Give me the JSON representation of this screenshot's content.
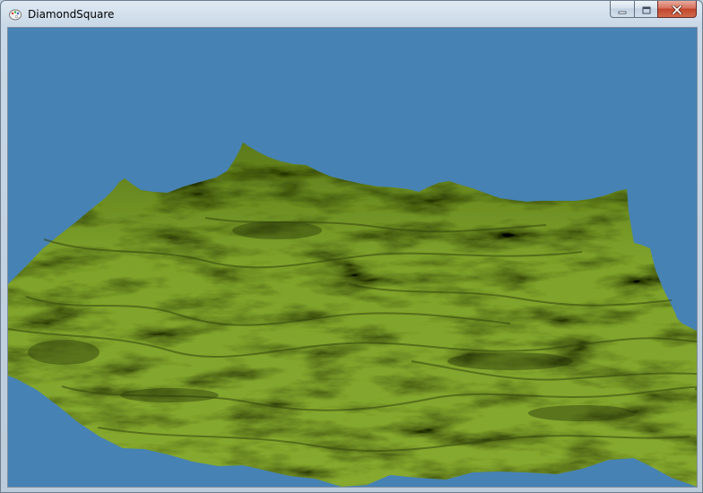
{
  "window": {
    "title": "DiamondSquare",
    "app_icon": "paint-palette-icon",
    "controls": {
      "minimize_icon": "minimize-icon",
      "maximize_icon": "maximize-icon",
      "close_icon": "close-icon"
    }
  },
  "scene": {
    "sky_color": "#4682b4",
    "terrain_color": "#7ea12a",
    "terrain_shadow_color": "#2f3e0c"
  }
}
